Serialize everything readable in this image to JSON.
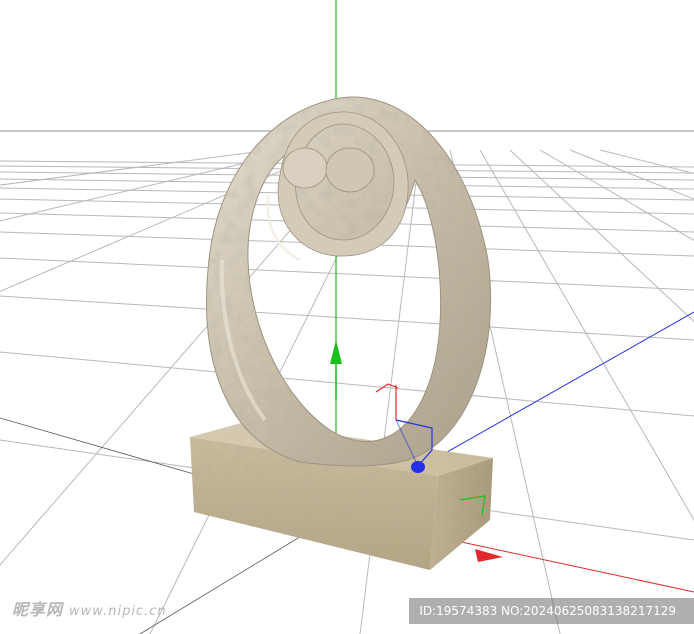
{
  "viewport": {
    "axis_colors": {
      "x": "#e0282c",
      "y": "#19c219",
      "z": "#2231e6"
    },
    "grid_color": "#b8b8b8",
    "horizon_color": "#909090",
    "model": "ring sculpture on a stone pedestal",
    "material_color": "#cbc2ae",
    "pedestal_color": "#c8bb9c",
    "icons": [
      "axis-gizmo-icon"
    ]
  },
  "watermark": {
    "brand": "昵享网",
    "url": "www.nipic.cn"
  },
  "id_badge": {
    "text": "ID:19574383 NO:20240625083138217129"
  }
}
